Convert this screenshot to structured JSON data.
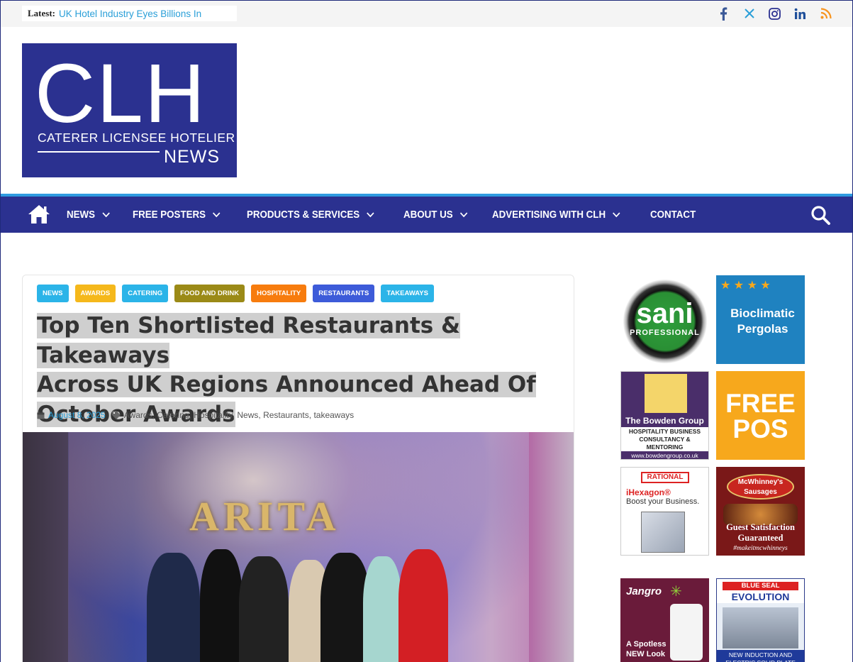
{
  "topbar": {
    "latest_label": "Latest:",
    "latest_headline": "UK Hotel Industry Eyes Billions In",
    "socials": [
      {
        "icon": "facebook-icon",
        "glyph": "f",
        "color": "#3b5998"
      },
      {
        "icon": "x-twitter-icon",
        "glyph": "𝕏",
        "color": "#2a9fd8"
      },
      {
        "icon": "instagram-icon",
        "glyph": "◎",
        "color": "#2b3190"
      },
      {
        "icon": "linkedin-icon",
        "glyph": "in",
        "color": "#1f4f9a"
      },
      {
        "icon": "rss-icon",
        "glyph": "◜",
        "color": "#f7941e"
      }
    ]
  },
  "logo": {
    "big": "CLH",
    "sub": "CATERER LICENSEE HOTELIER",
    "news": "NEWS"
  },
  "nav": {
    "items": [
      {
        "label": "NEWS",
        "dropdown": true
      },
      {
        "label": "FREE POSTERS",
        "dropdown": true
      },
      {
        "label": "PRODUCTS & SERVICES",
        "dropdown": true
      },
      {
        "label": "ABOUT US",
        "dropdown": true
      },
      {
        "label": "ADVERTISING WITH CLH",
        "dropdown": true
      },
      {
        "label": "CONTACT",
        "dropdown": false
      }
    ]
  },
  "article": {
    "categories": [
      {
        "label": "NEWS",
        "color": "#2bb4e8"
      },
      {
        "label": "AWARDS",
        "color": "#f5b81b"
      },
      {
        "label": "CATERING",
        "color": "#2bb4e8"
      },
      {
        "label": "FOOD AND DRINK",
        "color": "#9b8a17"
      },
      {
        "label": "HOSPITALITY",
        "color": "#f77c0e"
      },
      {
        "label": "RESTAURANTS",
        "color": "#3d5bd9"
      },
      {
        "label": "TAKEAWAYS",
        "color": "#2bb4e8"
      }
    ],
    "title_lines": [
      "Top Ten Shortlisted Restaurants & Takeaways",
      "Across UK Regions Announced Ahead Of",
      "October Awards"
    ],
    "date": "August 8, 2025",
    "tag_links": [
      "Awards",
      "Catering",
      "Hospitality",
      "News",
      "Restaurants",
      "takeaways"
    ],
    "hero_caption": "ARITA"
  },
  "sidebar_ads": {
    "sani": {
      "word": "sani",
      "sub": "PROFESSIONAL"
    },
    "bioclimatic": {
      "text": "Bioclimatic Pergolas"
    },
    "bowden": {
      "name": "The Bowden Group",
      "sub": "HOSPITALITY BUSINESS CONSULTANCY & MENTORING",
      "url": "www.bowdengroup.co.uk"
    },
    "free_pos": {
      "text": "FREE POS"
    },
    "rational": {
      "brand": "RATIONAL",
      "product": "iHexagon®",
      "tagline": "Boost your Business."
    },
    "mcwhinney": {
      "brand": "McWhinney's Sausages",
      "text": "Guest Satisfaction Guaranteed",
      "hashtag": "#makeitmcwhinneys"
    },
    "jangro": {
      "brand": "Jangro",
      "text": "A Spotless NEW Look"
    },
    "blue_seal": {
      "brand": "BLUE SEAL",
      "product": "EVOLUTION",
      "text": "NEW INDUCTION AND ELECTRIC SOLID PLATE HOBS"
    }
  }
}
